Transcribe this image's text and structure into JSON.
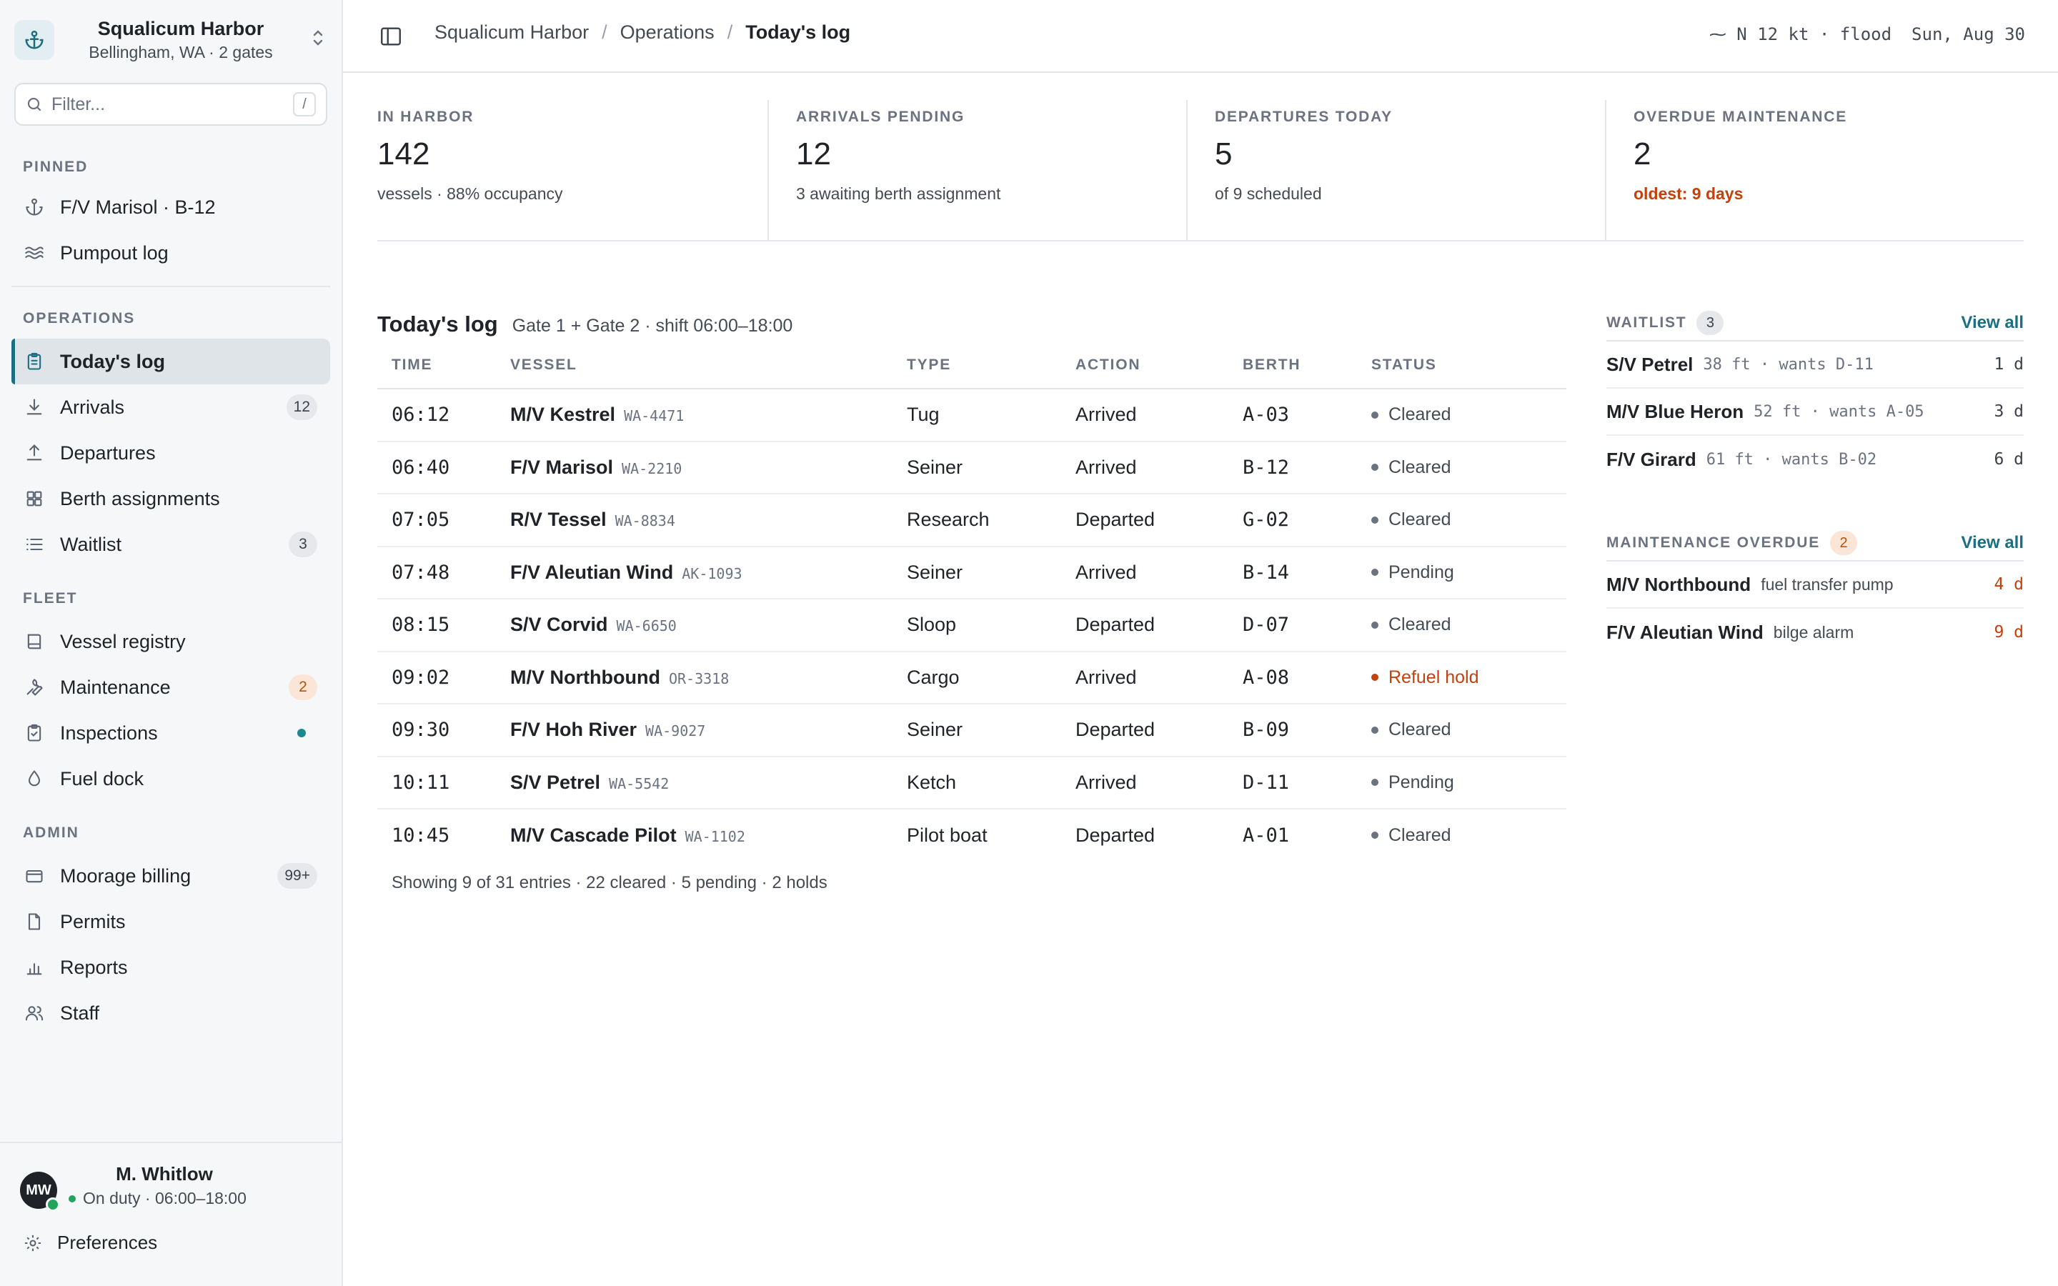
{
  "org": {
    "name": "Squalicum Harbor",
    "subtitle": "Bellingham, WA · 2 gates"
  },
  "filter": {
    "placeholder": "Filter...",
    "shortcut": "/"
  },
  "sidebar": {
    "pinned_label": "PINNED",
    "pinned": [
      {
        "label": "F/V Marisol · B-12",
        "icon": "anchor-icon"
      },
      {
        "label": "Pumpout log",
        "icon": "waves-icon"
      }
    ],
    "operations_label": "OPERATIONS",
    "operations": [
      {
        "label": "Today's log",
        "icon": "clipboard-icon",
        "active": true
      },
      {
        "label": "Arrivals",
        "icon": "download-icon",
        "badge": "12"
      },
      {
        "label": "Departures",
        "icon": "upload-icon"
      },
      {
        "label": "Berth assignments",
        "icon": "grid-icon"
      },
      {
        "label": "Waitlist",
        "icon": "list-icon",
        "badge": "3"
      }
    ],
    "fleet_label": "FLEET",
    "fleet": [
      {
        "label": "Vessel registry",
        "icon": "book-icon"
      },
      {
        "label": "Maintenance",
        "icon": "wrench-icon",
        "badge": "2"
      },
      {
        "label": "Inspections",
        "icon": "clipboard-check-icon",
        "dot": true
      },
      {
        "label": "Fuel dock",
        "icon": "droplet-icon"
      }
    ],
    "admin_label": "ADMIN",
    "admin": [
      {
        "label": "Moorage billing",
        "icon": "credit-card-icon",
        "badge": "99+"
      },
      {
        "label": "Permits",
        "icon": "file-icon"
      },
      {
        "label": "Reports",
        "icon": "bar-chart-icon"
      },
      {
        "label": "Staff",
        "icon": "users-icon"
      }
    ]
  },
  "user": {
    "initials": "MW",
    "name": "M. Whitlow",
    "status": "On duty · 06:00–18:00",
    "preferences": "Preferences"
  },
  "breadcrumb": {
    "root": "Squalicum Harbor",
    "section": "Operations",
    "current": "Today's log"
  },
  "topbar": {
    "conditions": "⁓ N 12 kt · flood",
    "date": "Sun, Aug 30"
  },
  "kpis": [
    {
      "label": "IN HARBOR",
      "value": "142",
      "sub": "vessels · 88% occupancy"
    },
    {
      "label": "ARRIVALS PENDING",
      "value": "12",
      "sub": "3 awaiting berth assignment"
    },
    {
      "label": "DEPARTURES TODAY",
      "value": "5",
      "sub": "of 9 scheduled"
    },
    {
      "label": "OVERDUE MAINTENANCE",
      "value": "2",
      "sub": "oldest: 9 days",
      "warn": true
    }
  ],
  "log": {
    "title": "Today's log",
    "subtitle": "Gate 1 + Gate 2 · shift 06:00–18:00",
    "columns": [
      "TIME",
      "VESSEL",
      "TYPE",
      "ACTION",
      "BERTH",
      "STATUS"
    ],
    "rows": [
      {
        "time": "06:12",
        "vessel": "M/V Kestrel",
        "reg": "WA-4471",
        "type": "Tug",
        "action": "Arrived",
        "berth": "A-03",
        "status": "Cleared"
      },
      {
        "time": "06:40",
        "vessel": "F/V Marisol",
        "reg": "WA-2210",
        "type": "Seiner",
        "action": "Arrived",
        "berth": "B-12",
        "status": "Cleared"
      },
      {
        "time": "07:05",
        "vessel": "R/V Tessel",
        "reg": "WA-8834",
        "type": "Research",
        "action": "Departed",
        "berth": "G-02",
        "status": "Cleared"
      },
      {
        "time": "07:48",
        "vessel": "F/V Aleutian Wind",
        "reg": "AK-1093",
        "type": "Seiner",
        "action": "Arrived",
        "berth": "B-14",
        "status": "Pending"
      },
      {
        "time": "08:15",
        "vessel": "S/V Corvid",
        "reg": "WA-6650",
        "type": "Sloop",
        "action": "Departed",
        "berth": "D-07",
        "status": "Cleared"
      },
      {
        "time": "09:02",
        "vessel": "M/V Northbound",
        "reg": "OR-3318",
        "type": "Cargo",
        "action": "Arrived",
        "berth": "A-08",
        "status": "Refuel hold",
        "hold": true
      },
      {
        "time": "09:30",
        "vessel": "F/V Hoh River",
        "reg": "WA-9027",
        "type": "Seiner",
        "action": "Departed",
        "berth": "B-09",
        "status": "Cleared"
      },
      {
        "time": "10:11",
        "vessel": "S/V Petrel",
        "reg": "WA-5542",
        "type": "Ketch",
        "action": "Arrived",
        "berth": "D-11",
        "status": "Pending"
      },
      {
        "time": "10:45",
        "vessel": "M/V Cascade Pilot",
        "reg": "WA-1102",
        "type": "Pilot boat",
        "action": "Departed",
        "berth": "A-01",
        "status": "Cleared"
      }
    ],
    "footer": "Showing 9 of 31 entries · 22 cleared · 5 pending · 2 holds"
  },
  "waitlist": {
    "title": "WAITLIST",
    "count": "3",
    "view_all": "View all",
    "items": [
      {
        "name": "S/V Petrel",
        "meta": "38 ft · wants D-11",
        "age": "1 d"
      },
      {
        "name": "M/V Blue Heron",
        "meta": "52 ft · wants A-05",
        "age": "3 d"
      },
      {
        "name": "F/V Girard",
        "meta": "61 ft · wants B-02",
        "age": "6 d"
      }
    ]
  },
  "maintenance": {
    "title": "MAINTENANCE OVERDUE",
    "count": "2",
    "view_all": "View all",
    "items": [
      {
        "name": "M/V Northbound",
        "meta": "fuel transfer pump",
        "age": "4 d"
      },
      {
        "name": "F/V Aleutian Wind",
        "meta": "bilge alarm",
        "age": "9 d"
      }
    ]
  },
  "colors": {
    "accent": "#1b6f80",
    "warning": "#c2410c",
    "online": "#22a45d"
  }
}
